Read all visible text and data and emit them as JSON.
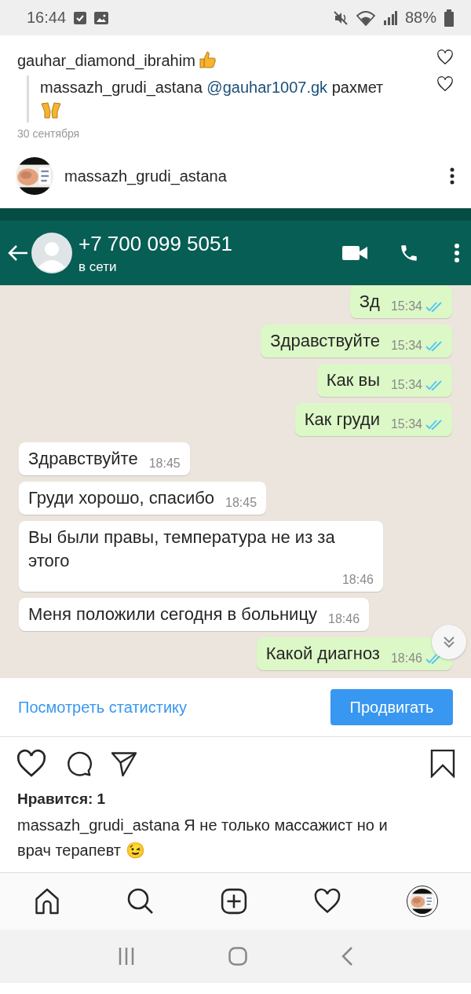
{
  "status_bar": {
    "time": "16:44",
    "battery": "88%"
  },
  "comments": [
    {
      "kind": "top",
      "username": "gauhar_diamond_ibrahim"
    },
    {
      "kind": "reply",
      "username": "massazh_grudi_astana",
      "mention": "@gauhar1007.gk",
      "text": "рахмет"
    }
  ],
  "date": "30 сентября",
  "post": {
    "username": "massazh_grudi_astana"
  },
  "chat": {
    "contact": "+7 700 099 5051",
    "status": "в сети",
    "messages": [
      {
        "kind": "out",
        "text": "Зд",
        "time": "15:34",
        "read": true
      },
      {
        "kind": "out",
        "text": "Здравствуйте",
        "time": "15:34",
        "read": true
      },
      {
        "kind": "out",
        "text": "Как вы",
        "time": "15:34",
        "read": true
      },
      {
        "kind": "out",
        "text": "Как груди",
        "time": "15:34",
        "read": true
      },
      {
        "kind": "in",
        "text": "Здравствуйте",
        "time": "18:45"
      },
      {
        "kind": "in",
        "text": "Груди хорошо, спасибо",
        "time": "18:45"
      },
      {
        "kind": "in",
        "text": "Вы были правы, температура не из за этого",
        "time": "18:46"
      },
      {
        "kind": "in",
        "text": "Меня положили сегодня в больницу",
        "time": "18:46"
      },
      {
        "kind": "out",
        "text": "Какой диагноз",
        "time": "18:46",
        "read": true
      }
    ]
  },
  "stats_link": "Посмотреть статистику",
  "promote_button": "Продвигать",
  "likes": "Нравится: 1",
  "caption": {
    "username": "massazh_grudi_astana",
    "text": "Я не только массажист но и врач терапевт 😉"
  }
}
